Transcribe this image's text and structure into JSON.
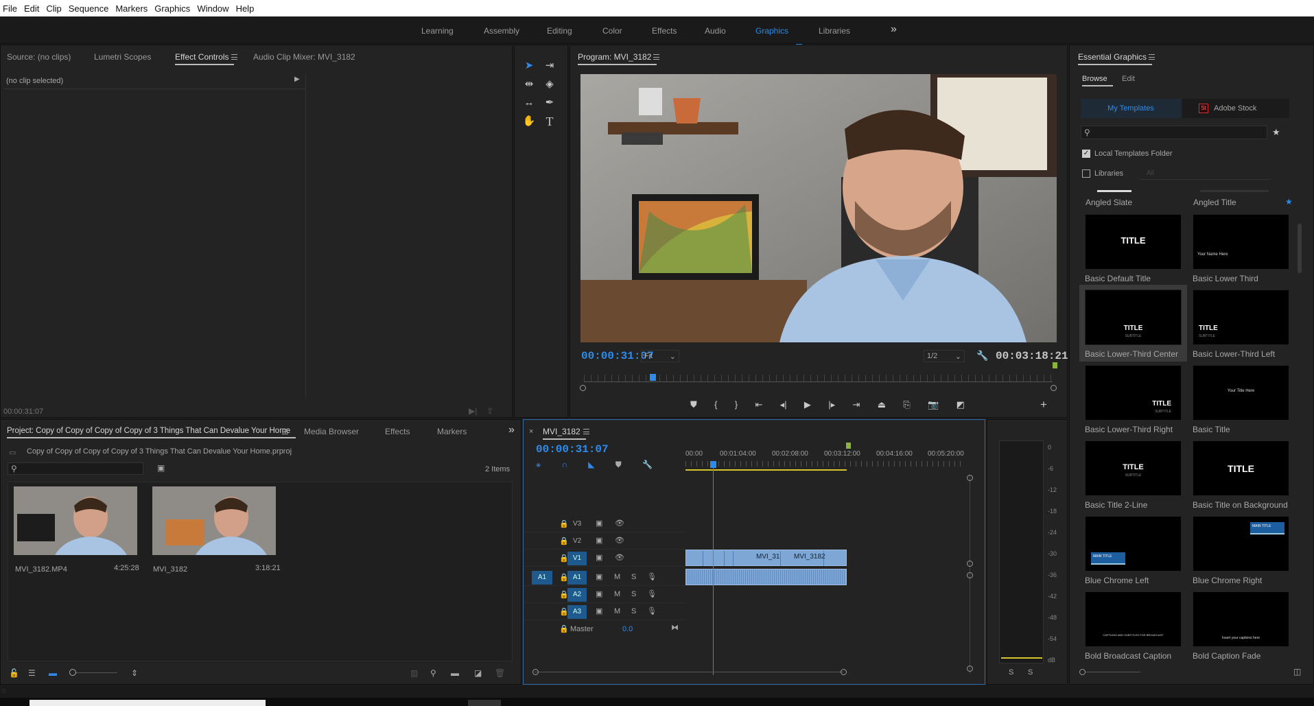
{
  "menu": [
    "File",
    "Edit",
    "Clip",
    "Sequence",
    "Markers",
    "Graphics",
    "Window",
    "Help"
  ],
  "workspaces": [
    "Learning",
    "Assembly",
    "Editing",
    "Color",
    "Effects",
    "Audio",
    "Graphics",
    "Libraries"
  ],
  "workspace_active": "Graphics",
  "overflow": "»",
  "source_tabs": [
    "Source: (no clips)",
    "Lumetri Scopes",
    "Effect Controls",
    "Audio Clip Mixer: MVI_3182"
  ],
  "no_clip": "(no clip selected)",
  "source_timecode": "00:00:31:07",
  "program": {
    "title": "Program: MVI_3182",
    "timecode": "00:00:31:07",
    "fit": "Fit",
    "resolution": "1/2",
    "duration": "00:03:18:21"
  },
  "project": {
    "tabs": [
      "Project: Copy of Copy of Copy of Copy of 3 Things That Can Devalue Your Home",
      "Media Browser",
      "Effects",
      "Markers"
    ],
    "file": "Copy of Copy of Copy of Copy of 3 Things That Can Devalue Your Home.prproj",
    "count": "2 Items",
    "items": [
      {
        "name": "MVI_3182.MP4",
        "dur": "4:25:28"
      },
      {
        "name": "MVI_3182",
        "dur": "3:18:21"
      }
    ]
  },
  "timeline": {
    "tab": "MVI_3182",
    "timecode": "00:00:31:07",
    "ruler": [
      "00:00",
      "00:01:04:00",
      "00:02:08:00",
      "00:03:12:00",
      "00:04:16:00",
      "00:05:20:00"
    ],
    "tracks": [
      "V3",
      "V2",
      "V1",
      "A1",
      "A2",
      "A3"
    ],
    "master": "Master",
    "master_val": "0.0",
    "source_patch": "A1",
    "clip_label": "MVI_3182",
    "clip_label_short": "MVI_31"
  },
  "meter": {
    "ticks": [
      "0",
      "-6",
      "-12",
      "-18",
      "-24",
      "-30",
      "-36",
      "-42",
      "-48",
      "-54",
      "dB"
    ],
    "solo": "S"
  },
  "essential": {
    "title": "Essential Graphics",
    "tabs": [
      "Browse",
      "Edit"
    ],
    "sources": [
      "My Templates",
      "Adobe Stock"
    ],
    "stock_badge": "St",
    "local": "Local Templates Folder",
    "libraries": "Libraries",
    "lib_select": "All",
    "top_labels": [
      "Angled Slate",
      "Angled Title"
    ],
    "templates": [
      "Basic Default Title",
      "Basic Lower Third",
      "Basic Lower-Third Center",
      "Basic Lower-Third Left",
      "Basic Lower-Third Right",
      "Basic Title",
      "Basic Title 2-Line",
      "Basic Title on Background",
      "Blue Chrome Left",
      "Blue Chrome Right",
      "Bold Broadcast Caption",
      "Bold Caption Fade"
    ],
    "thumb_text": {
      "title": "TITLE",
      "subtitle": "SUBTITLE",
      "your_name": "Your Name Here",
      "your_title": "Your Title Here",
      "main_title": "MAIN TITLE",
      "caption": "CAPTIONS AND SUBTITLES FOR BROADCAST",
      "insert_caption": "Insert your captions here"
    }
  },
  "colors": {
    "accent": "#2d8ceb",
    "clip": "#7ea7d6",
    "playhead": "#2d8ceb",
    "workarea": "#d6c62a"
  }
}
